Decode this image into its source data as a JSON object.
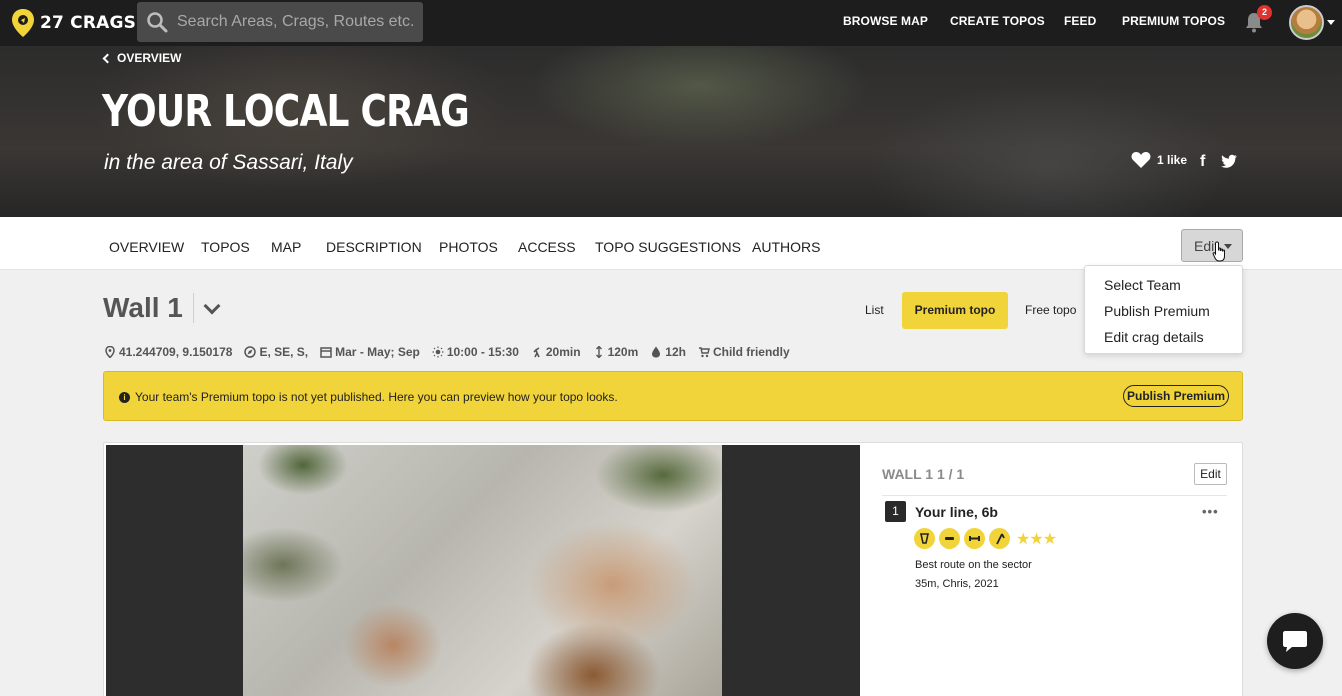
{
  "brand": {
    "name": "27 CRAGS",
    "accent": "#f1d43a"
  },
  "search": {
    "placeholder": "Search Areas, Crags, Routes etc."
  },
  "nav": {
    "links": [
      "BROWSE MAP",
      "CREATE TOPOS",
      "FEED",
      "PREMIUM TOPOS"
    ],
    "notification_count": "2"
  },
  "hero": {
    "back_label": "OVERVIEW",
    "title": "YOUR LOCAL CRAG",
    "subtitle": "in the area of Sassari, Italy",
    "likes": "1 like"
  },
  "tabs": [
    "OVERVIEW",
    "TOPOS",
    "MAP",
    "DESCRIPTION",
    "PHOTOS",
    "ACCESS",
    "TOPO SUGGESTIONS",
    "AUTHORS"
  ],
  "edit_menu": {
    "button_label": "Edit",
    "items": [
      "Select Team",
      "Publish Premium",
      "Edit crag details"
    ]
  },
  "wall": {
    "title": "Wall 1",
    "views": {
      "list": "List",
      "premium": "Premium topo",
      "free": "Free topo"
    },
    "meta": {
      "coords": "41.244709, 9.150178",
      "aspect": "E, SE, S,",
      "season": "Mar - May; Sep",
      "sun": "10:00 - 15:30",
      "approach": "20min",
      "height": "120m",
      "dry": "12h",
      "child": "Child friendly"
    }
  },
  "notice": {
    "text": "Your team's Premium topo is not yet published. Here you can preview how your topo looks.",
    "button": "Publish Premium"
  },
  "topo": {
    "header": "WALL 1 1 / 1",
    "edit_label": "Edit",
    "route": {
      "number": "1",
      "name": "Your line, 6b",
      "stars": "★★★",
      "description": "Best route on the sector",
      "info": "35m, Chris, 2021",
      "more": "•••"
    }
  }
}
